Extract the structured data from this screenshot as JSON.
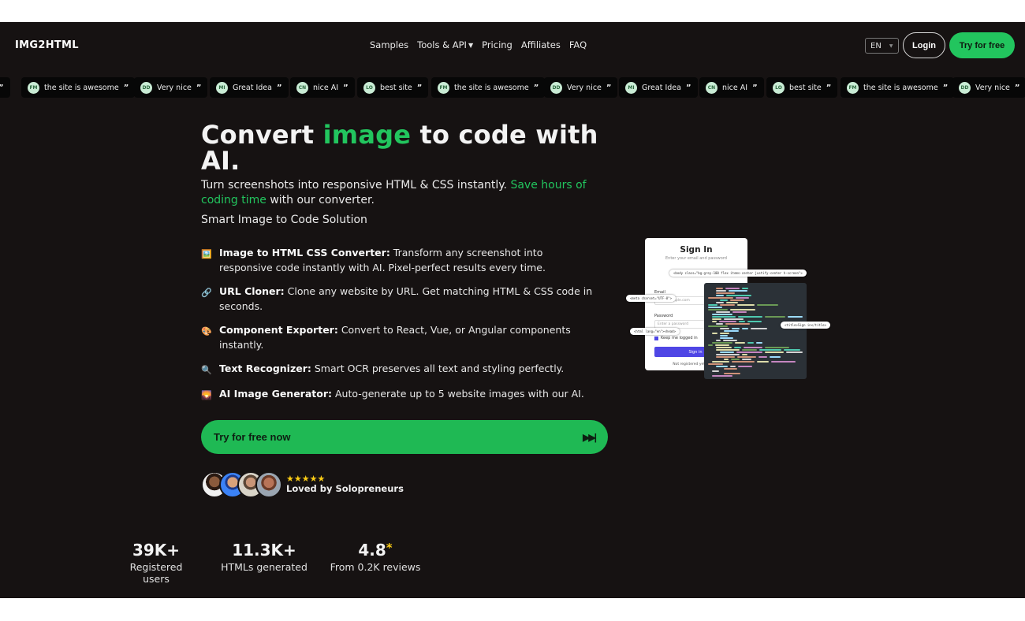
{
  "header": {
    "logo": "IMG2HTML",
    "nav": [
      {
        "label": "Samples"
      },
      {
        "label": "Tools & API",
        "has_dropdown": true
      },
      {
        "label": "Pricing"
      },
      {
        "label": "Affiliates"
      },
      {
        "label": "FAQ"
      }
    ],
    "language": "EN",
    "login_label": "Login",
    "try_label": "Try for free"
  },
  "ticker": [
    {
      "initials": "FM",
      "text": "the site is awesome"
    },
    {
      "initials": "DD",
      "text": "Very nice"
    },
    {
      "initials": "MI",
      "text": "Great Idea"
    },
    {
      "initials": "CN",
      "text": "nice AI"
    },
    {
      "initials": "LO",
      "text": "best site"
    },
    {
      "initials": "FM",
      "text": "the site is awesome"
    },
    {
      "initials": "DD",
      "text": "Very nice"
    },
    {
      "initials": "MI",
      "text": "Great Idea"
    },
    {
      "initials": "CN",
      "text": "nice AI"
    },
    {
      "initials": "LO",
      "text": "best site"
    },
    {
      "initials": "FM",
      "text": "the site is awesome"
    },
    {
      "initials": "DD",
      "text": "Very nice"
    }
  ],
  "hero": {
    "title_before": "Convert ",
    "title_highlight": "image",
    "title_after": " to code with AI.",
    "subtitle_before": "Turn screenshots into responsive HTML & CSS instantly. ",
    "subtitle_highlight": "Save hours of coding time",
    "subtitle_after": " with our converter.",
    "tagline": "Smart Image to Code Solution"
  },
  "features": [
    {
      "icon": "framed-picture-icon",
      "glyph": "🖼️",
      "title": "Image to HTML CSS Converter:",
      "text": " Transform any screenshot into responsive code instantly with AI. Pixel-perfect results every time."
    },
    {
      "icon": "link-icon",
      "glyph": "🔗",
      "title": "URL Cloner:",
      "text": " Clone any website by URL. Get matching HTML & CSS code in seconds."
    },
    {
      "icon": "palette-icon",
      "glyph": "🎨",
      "title": "Component Exporter:",
      "text": " Convert to React, Vue, or Angular components instantly."
    },
    {
      "icon": "magnifier-icon",
      "glyph": "🔍",
      "title": "Text Recognizer:",
      "text": " Smart OCR preserves all text and styling perfectly."
    },
    {
      "icon": "sunset-image-icon",
      "glyph": "🌄",
      "title": "AI Image Generator:",
      "text": " Auto-generate up to 5 website images with our AI."
    }
  ],
  "cta": {
    "label": "Try for free now",
    "icon": "fast-forward-icon"
  },
  "social_proof": {
    "stars": "★★★★★",
    "label": "Loved by Solopreneurs"
  },
  "stats": [
    {
      "value": "39K+",
      "label": "Registered users"
    },
    {
      "value": "11.3K+",
      "label": "HTMLs generated"
    },
    {
      "value": "4.8",
      "star": "*",
      "label": "From 0.2K reviews"
    }
  ],
  "illustration": {
    "signin_title": "Sign In",
    "signin_sub": "Enter your email and password",
    "email_label": "Email",
    "email_value": "name@apple.com",
    "password_label": "Password",
    "password_value": "Enter a password",
    "keep_label": "Keep me logged in",
    "button_label": "Sign in",
    "not_registered": "Not registered yet? Create",
    "tag_body": "<body class=\"bg-grey-100 flex items-center justify-center h-screen\">",
    "tag_meta": "<meta charset=\"UTF-8\">",
    "tag_html": "<html lang=\"en\"><head>",
    "tag_title": "<title>Sign in</title>"
  },
  "colors": {
    "accent": "#22c55e",
    "background": "#161212",
    "star": "#facc15"
  }
}
